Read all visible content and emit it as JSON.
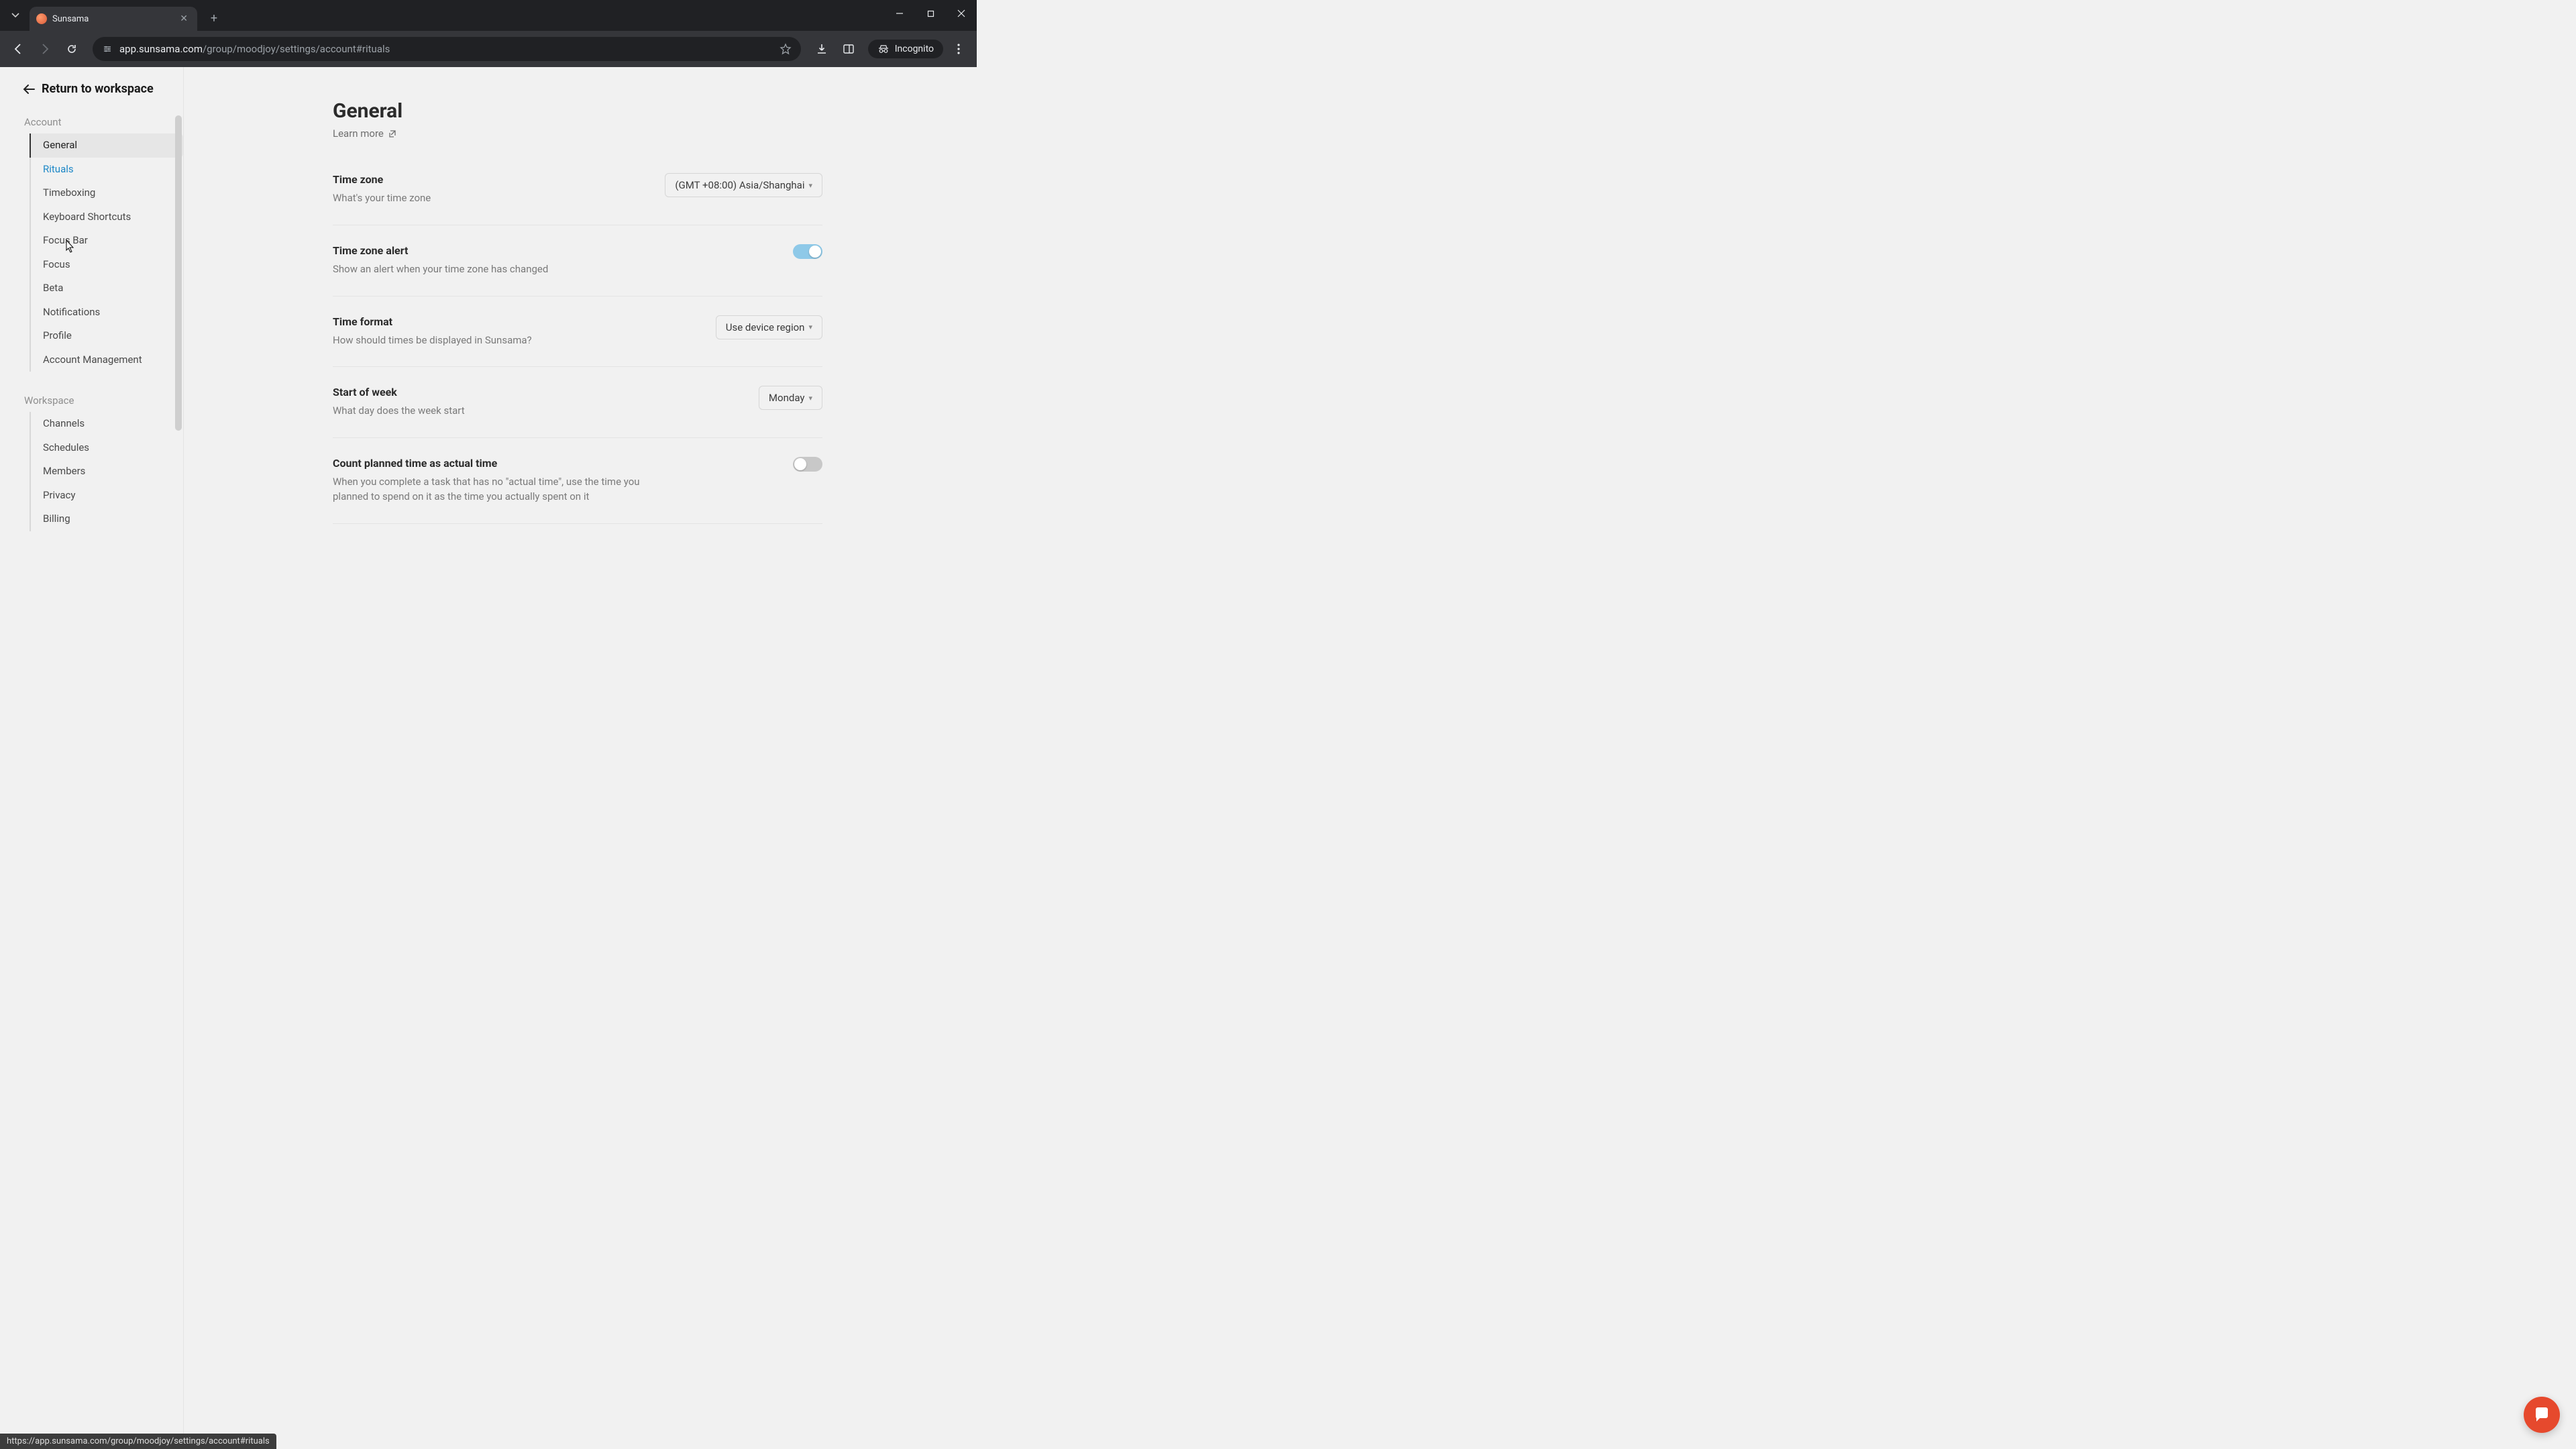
{
  "browser": {
    "tab_title": "Sunsama",
    "url_host": "app.sunsama.com",
    "url_path": "/group/moodjoy/settings/account#rituals",
    "incognito_label": "Incognito",
    "status_url": "https://app.sunsama.com/group/moodjoy/settings/account#rituals"
  },
  "return_label": "Return to workspace",
  "sidebar": {
    "sections": [
      {
        "title": "Account",
        "items": [
          {
            "label": "General",
            "state": "active"
          },
          {
            "label": "Rituals",
            "state": "hover"
          },
          {
            "label": "Timeboxing",
            "state": ""
          },
          {
            "label": "Keyboard Shortcuts",
            "state": ""
          },
          {
            "label": "Focus Bar",
            "state": ""
          },
          {
            "label": "Focus",
            "state": ""
          },
          {
            "label": "Beta",
            "state": ""
          },
          {
            "label": "Notifications",
            "state": ""
          },
          {
            "label": "Profile",
            "state": ""
          },
          {
            "label": "Account Management",
            "state": ""
          }
        ]
      },
      {
        "title": "Workspace",
        "items": [
          {
            "label": "Channels",
            "state": ""
          },
          {
            "label": "Schedules",
            "state": ""
          },
          {
            "label": "Members",
            "state": ""
          },
          {
            "label": "Privacy",
            "state": ""
          },
          {
            "label": "Billing",
            "state": ""
          }
        ]
      }
    ]
  },
  "page": {
    "title": "General",
    "learn_more": "Learn more"
  },
  "settings": [
    {
      "title": "Time zone",
      "desc": "What's your time zone",
      "control": "select",
      "value": "(GMT +08:00) Asia/Shanghai"
    },
    {
      "title": "Time zone alert",
      "desc": "Show an alert when your time zone has changed",
      "control": "toggle",
      "on": true
    },
    {
      "title": "Time format",
      "desc": "How should times be displayed in Sunsama?",
      "control": "select",
      "value": "Use device region"
    },
    {
      "title": "Start of week",
      "desc": "What day does the week start",
      "control": "select",
      "value": "Monday"
    },
    {
      "title": "Count planned time as actual time",
      "desc": "When you complete a task that has no \"actual time\", use the time you planned to spend on it as the time you actually spent on it",
      "control": "toggle",
      "on": false
    }
  ]
}
